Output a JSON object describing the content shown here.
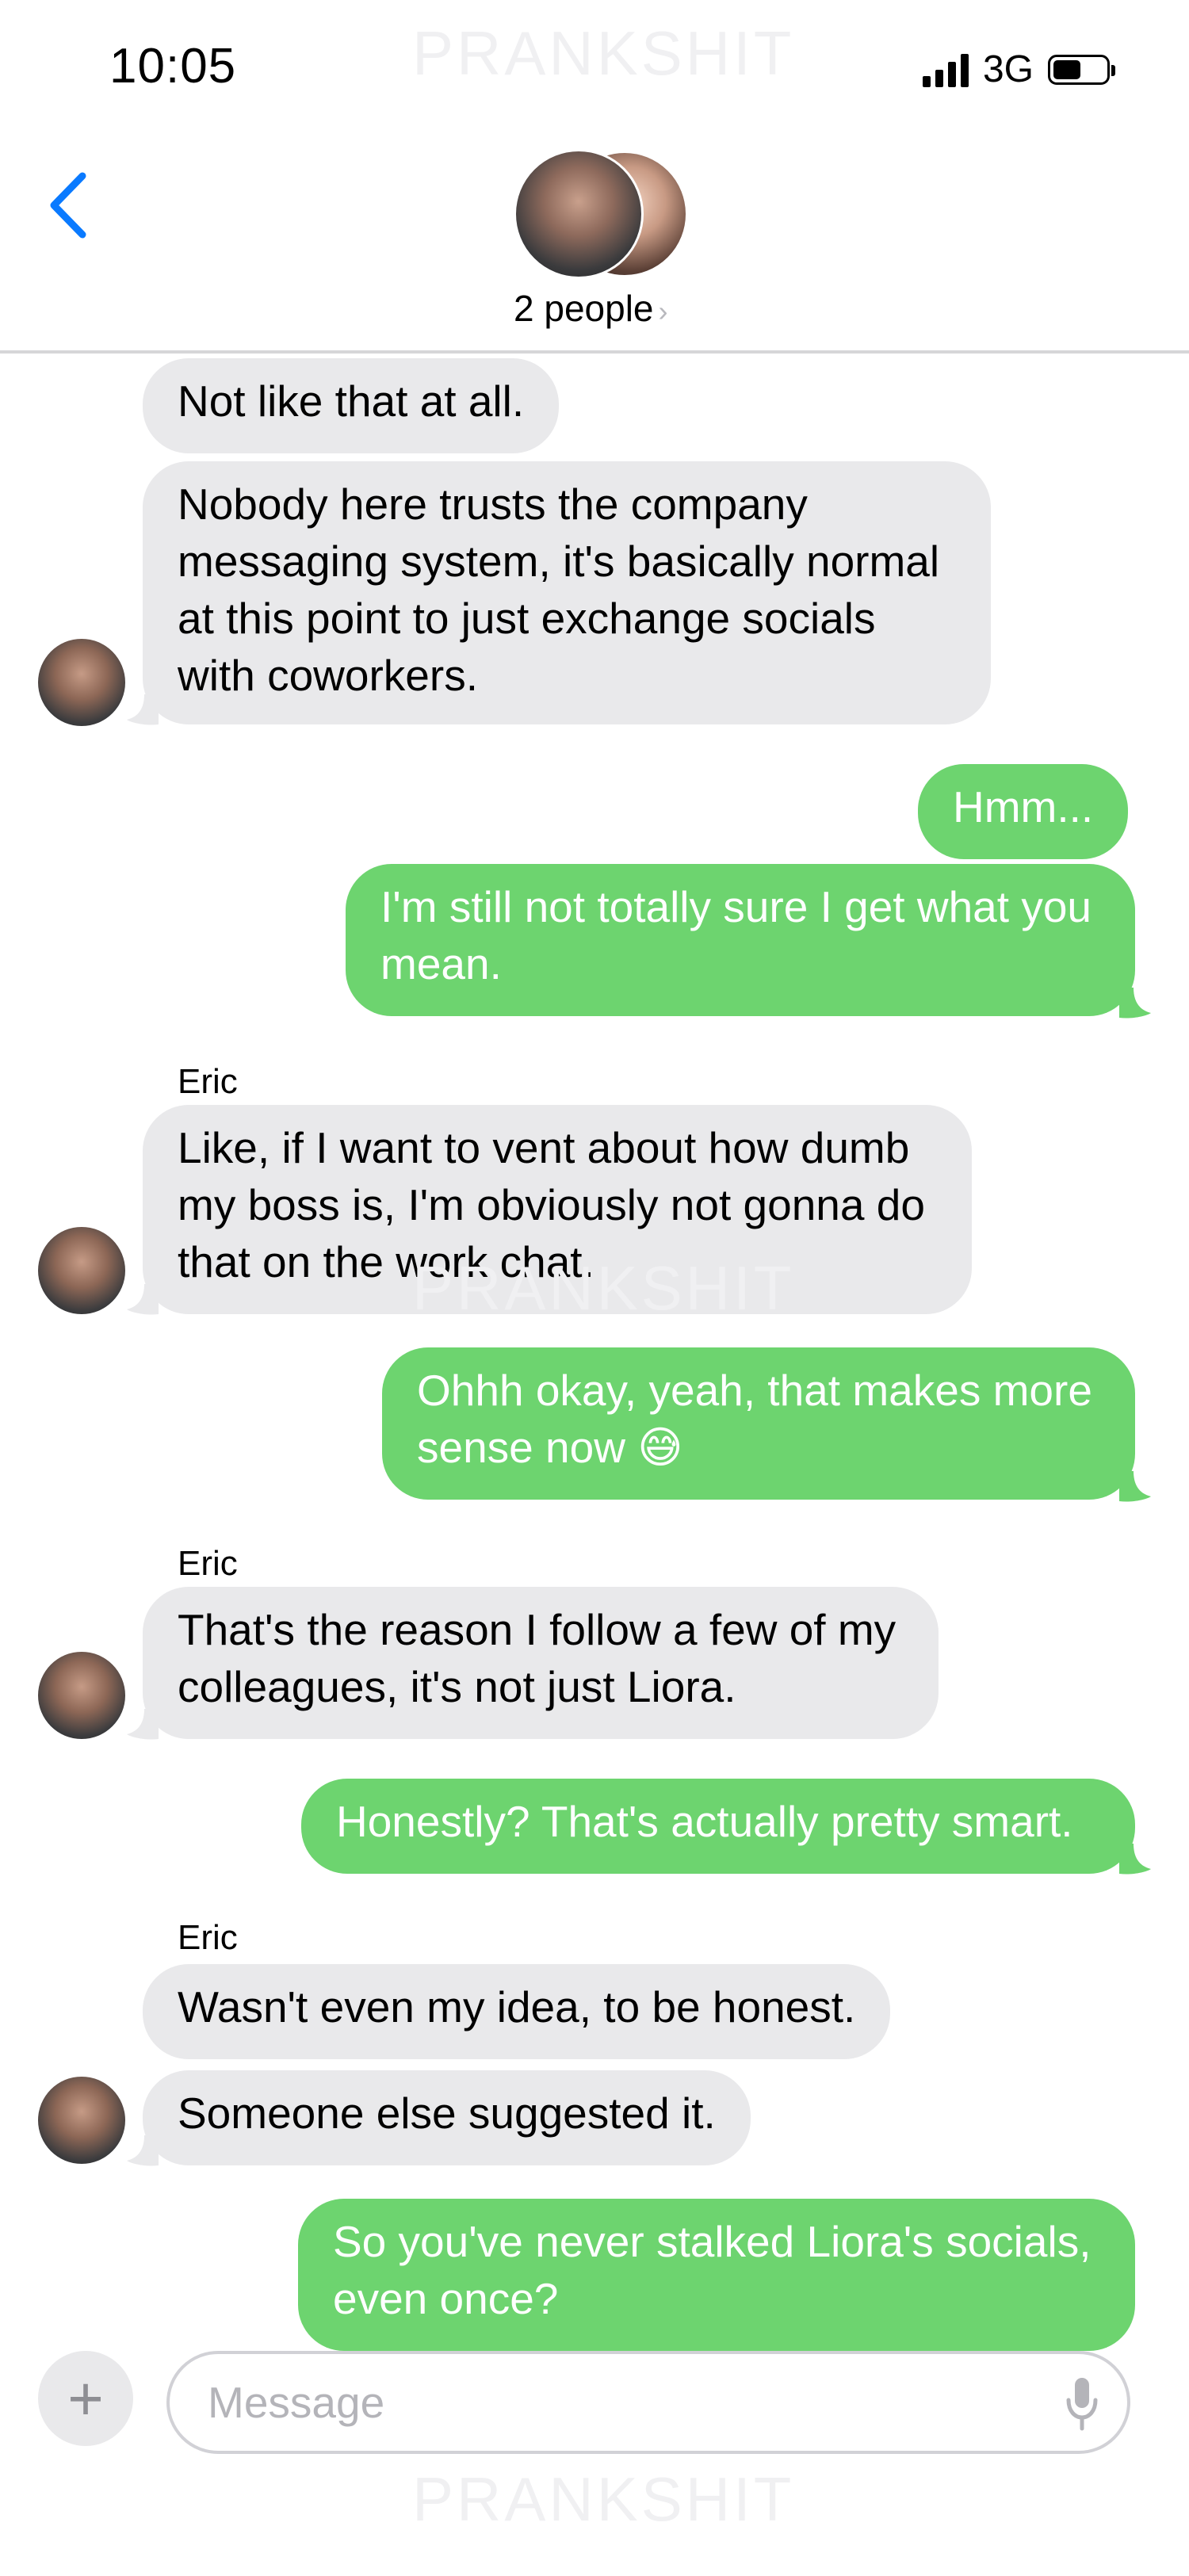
{
  "status": {
    "time": "10:05",
    "network": "3G",
    "battery_level": 0.5
  },
  "watermark": "PRANKSHIT",
  "header": {
    "participants": "2 people",
    "chevron": "›"
  },
  "messages": [
    {
      "dir": "in",
      "text": "Not like that at all."
    },
    {
      "dir": "in",
      "text": "Nobody here trusts the company\nmessaging system, it's basically normal\nat this point to just exchange socials\nwith coworkers."
    },
    {
      "dir": "out",
      "text": "Hmm..."
    },
    {
      "dir": "out",
      "text": "I'm still not totally sure I get what you\nmean."
    },
    {
      "dir": "in",
      "sender": "Eric",
      "text": "Like, if I want to vent about how dumb\nmy boss is, I'm obviously not gonna do\nthat on the work chat."
    },
    {
      "dir": "out",
      "text": "Ohhh okay, yeah, that makes more\nsense now 😅"
    },
    {
      "dir": "in",
      "sender": "Eric",
      "text": "That's the reason I follow a few of my\ncolleagues, it's not just Liora."
    },
    {
      "dir": "out",
      "text": "Honestly? That's actually pretty smart."
    },
    {
      "dir": "in",
      "sender": "Eric",
      "text": "Wasn't even my idea, to be honest."
    },
    {
      "dir": "in",
      "text": "Someone else suggested it."
    },
    {
      "dir": "out",
      "text": "So you've never stalked Liora's socials,\neven once?"
    }
  ],
  "input": {
    "placeholder": "Message",
    "plus": "+"
  },
  "colors": {
    "accent": "#0a7aff",
    "outgoing": "#6dd46f",
    "incoming": "#e9e9eb"
  }
}
